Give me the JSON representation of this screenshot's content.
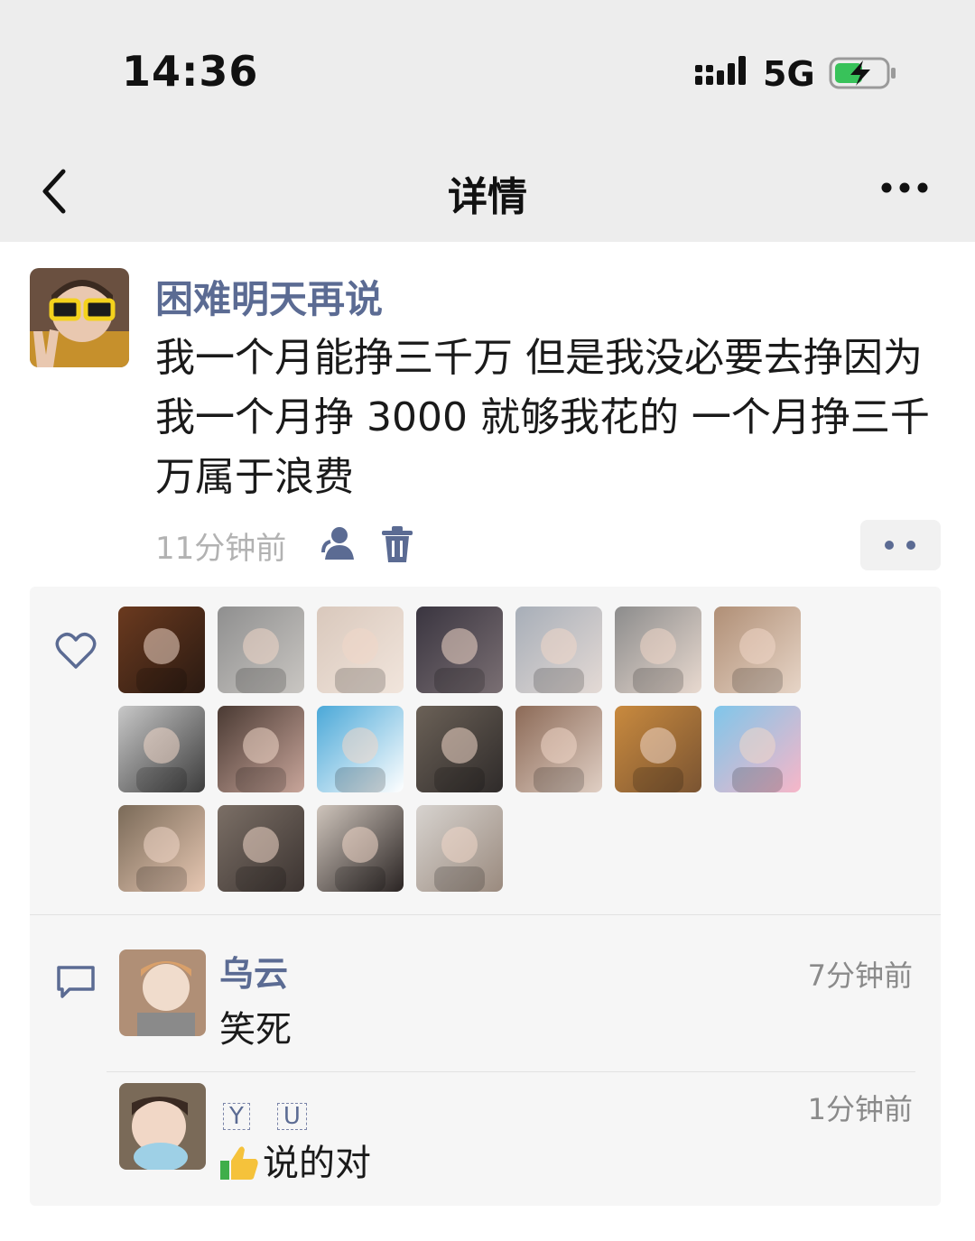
{
  "status_bar": {
    "time": "14:36",
    "network": "5G"
  },
  "nav": {
    "title": "详情"
  },
  "post": {
    "author": "困难明天再说",
    "text": "我一个月能挣三千万 但是我没必要去挣因为我一个月挣 3000 就够我花的 一个月挣三千万属于浪费",
    "time": "11分钟前"
  },
  "likes": {
    "count_visible": 18,
    "tile_colors": [
      [
        "#6b3a1f",
        "#2a1a12"
      ],
      [
        "#8f8f8f",
        "#c9c6c2"
      ],
      [
        "#d9c8bc",
        "#f1e5dc"
      ],
      [
        "#3a3540",
        "#7a6f73"
      ],
      [
        "#a7aeb8",
        "#e4dad5"
      ],
      [
        "#8c8c8c",
        "#e8d9cf"
      ],
      [
        "#b08f76",
        "#e7d5c7"
      ],
      [
        "#c8c8c8",
        "#3c3c3c"
      ],
      [
        "#4a3a33",
        "#c8a59a"
      ],
      [
        "#4aa8d8",
        "#ffffff"
      ],
      [
        "#6b6157",
        "#2f2b2a"
      ],
      [
        "#8c6a57",
        "#e0cfc4"
      ],
      [
        "#c98a3e",
        "#7a5432"
      ],
      [
        "#7fc6ea",
        "#f7b6c8"
      ],
      [
        "#7a6a58",
        "#e6c7b2"
      ],
      [
        "#7b6f66",
        "#3c3431"
      ],
      [
        "#cfc5bc",
        "#2a2423"
      ],
      [
        "#d7d3cf",
        "#9a8a7e"
      ]
    ]
  },
  "comments": [
    {
      "name": "乌云",
      "text": "笑死",
      "time": "7分钟前"
    },
    {
      "name_chars": [
        "Y",
        "U"
      ],
      "text": "说的对",
      "time": "1分钟前"
    }
  ]
}
